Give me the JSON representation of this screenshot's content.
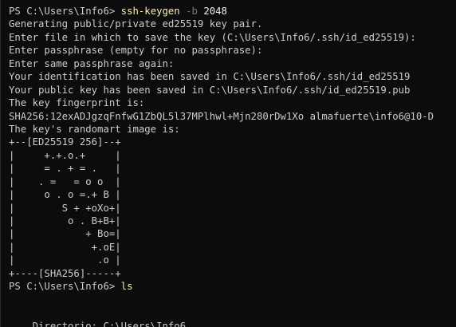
{
  "terminal": {
    "prompt": "PS C:\\Users\\Info6> ",
    "cmd1": {
      "name": "ssh-keygen",
      "flag": "-b",
      "value": "2048"
    },
    "output": [
      "Generating public/private ed25519 key pair.",
      "Enter file in which to save the key (C:\\Users\\Info6/.ssh/id_ed25519):",
      "Enter passphrase (empty for no passphrase):",
      "Enter same passphrase again:",
      "Your identification has been saved in C:\\Users\\Info6/.ssh/id_ed25519",
      "Your public key has been saved in C:\\Users\\Info6/.ssh/id_ed25519.pub",
      "The key fingerprint is:",
      "SHA256:12exADJgzqFnfwG1ZbQL5l37MPlhwl+Mjn280rDw1Xo almafuerte\\info6@10-D",
      "The key's randomart image is:",
      "+--[ED25519 256]--+",
      "|     +.+.o.+     |",
      "|     = . + = .   |",
      "|    . =   = o o  |",
      "|     o . o =.+ B |",
      "|        S + +oXo+|",
      "|         o . B+B+|",
      "|            + Bo=|",
      "|             +.oE|",
      "|              .o |",
      "+----[SHA256]-----+"
    ],
    "cmd2": {
      "name": "ls"
    },
    "directory_line": "    Directorio: C:\\Users\\Info6"
  }
}
